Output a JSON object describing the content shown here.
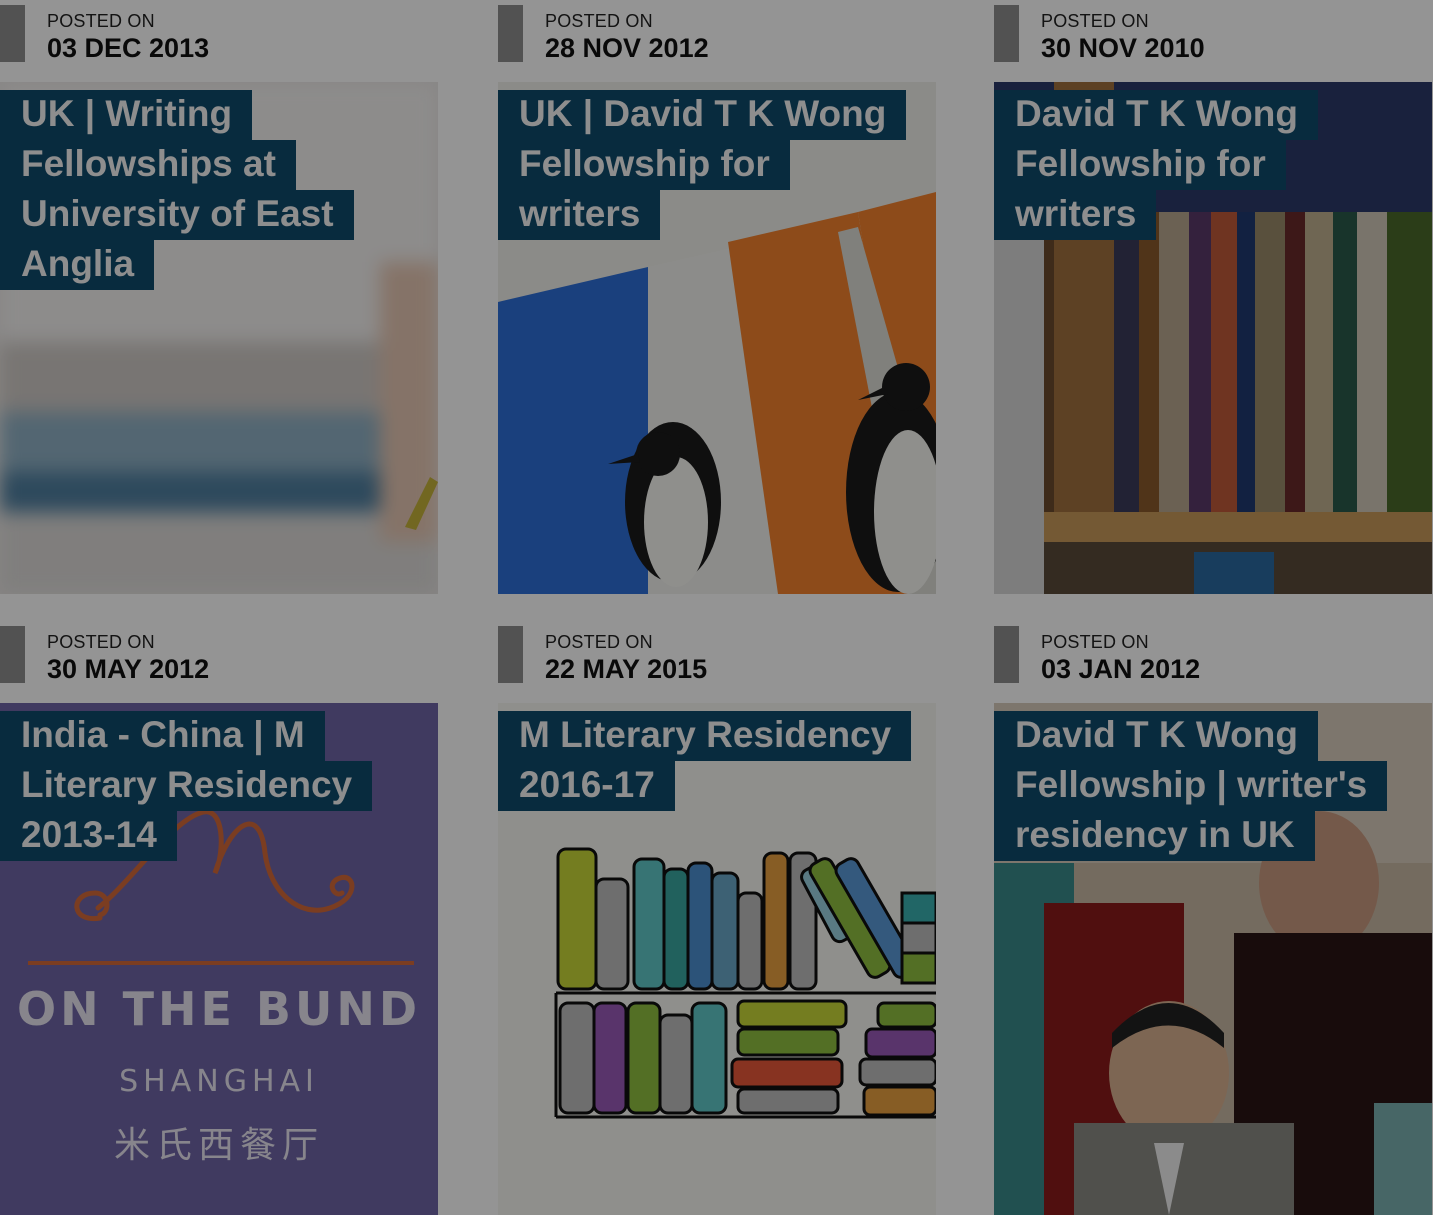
{
  "posts": [
    {
      "posted_label": "POSTED ON",
      "date": "03 DEC 2013",
      "title": "UK | Writing Fellowships at University of East Anglia",
      "thumbnail": "writing-desk-photo"
    },
    {
      "posted_label": "POSTED ON",
      "date": "28 NOV 2012",
      "title": "UK | David T K Wong Fellowship for writers",
      "thumbnail": "penguin-books-photo"
    },
    {
      "posted_label": "POSTED ON",
      "date": "30 NOV 2010",
      "title": "David T K Wong Fellowship for writers",
      "thumbnail": "bookshelf-photo"
    },
    {
      "posted_label": "POSTED ON",
      "date": "30 MAY 2012",
      "title": "India - China | M Literary Residency 2013-14",
      "thumbnail": "m-on-the-bund-logo"
    },
    {
      "posted_label": "POSTED ON",
      "date": "22 MAY 2015",
      "title": "M Literary Residency 2016-17",
      "thumbnail": "bookshelf-illustration"
    },
    {
      "posted_label": "POSTED ON",
      "date": "03 JAN 2012",
      "title": "David T K Wong Fellowship | writer's residency in UK",
      "thumbnail": "group-photo"
    }
  ],
  "logo": {
    "line1": "ON THE BUND",
    "line2": "SHANGHAI",
    "line3": "米氏西餐厅"
  },
  "colors": {
    "title_bg": "#0f4a6c",
    "bar": "#8e8e8e",
    "overlay": "rgba(0,0,0,0.42)"
  }
}
